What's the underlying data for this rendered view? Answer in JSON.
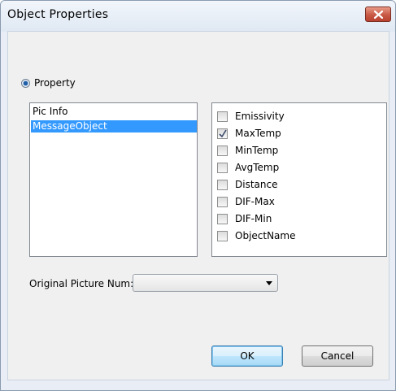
{
  "window": {
    "title": "Object Properties",
    "close_icon": "close-icon"
  },
  "mode": {
    "radio_label": "Property",
    "selected": true
  },
  "left_list": {
    "items": [
      {
        "label": "Pic Info",
        "selected": false
      },
      {
        "label": "MessageObject",
        "selected": true
      }
    ]
  },
  "right_list": {
    "items": [
      {
        "label": "Emissivity",
        "checked": false
      },
      {
        "label": "MaxTemp",
        "checked": true
      },
      {
        "label": "MinTemp",
        "checked": false
      },
      {
        "label": "AvgTemp",
        "checked": false
      },
      {
        "label": "Distance",
        "checked": false
      },
      {
        "label": "DIF-Max",
        "checked": false
      },
      {
        "label": "DIF-Min",
        "checked": false
      },
      {
        "label": "ObjectName",
        "checked": false
      }
    ]
  },
  "combo": {
    "label": "Original Picture Num:",
    "value": ""
  },
  "buttons": {
    "ok_label": "OK",
    "cancel_label": "Cancel"
  },
  "colors": {
    "selection": "#3399ff",
    "close_button": "#c85945"
  }
}
